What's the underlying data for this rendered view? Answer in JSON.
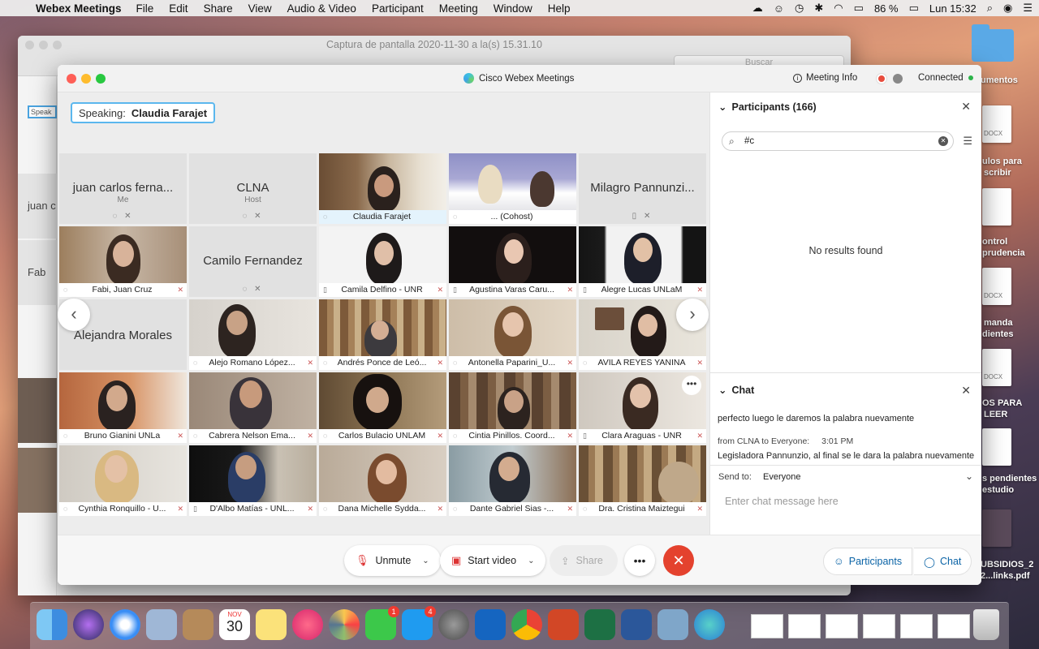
{
  "menubar": {
    "app": "Webex Meetings",
    "items": [
      "File",
      "Edit",
      "Share",
      "View",
      "Audio & Video",
      "Participant",
      "Meeting",
      "Window",
      "Help"
    ],
    "battery": "86 %",
    "clock": "Lun 15:32"
  },
  "desktop": {
    "labels": [
      "umentos",
      "ulos para",
      "scribir",
      "ontrol",
      "prudencia",
      "manda",
      "dientes",
      "OS PARA",
      "LEER",
      "s pendientes",
      "estudio",
      "UBSIDIOS_2",
      "2...links.pdf"
    ],
    "docx": [
      "DOCX",
      "DOCX",
      "DOCX"
    ]
  },
  "bg_window": {
    "title": "Captura de pantalla 2020-11-30 a la(s) 15.31.10",
    "search_placeholder": "Buscar",
    "thumb_label": "Speak",
    "ghosts": [
      "juan c",
      "Fab"
    ]
  },
  "window": {
    "title": "Cisco Webex Meetings",
    "meeting_info": "Meeting Info",
    "status": "Connected",
    "colors": {
      "accent": "#5bb7ee",
      "end": "#e4422e",
      "link": "#0a63a6"
    }
  },
  "speaking": {
    "label": "Speaking:",
    "name": "Claudia Farajet"
  },
  "tiles": [
    {
      "name": "juan carlos ferna...",
      "role": "Me",
      "video": false
    },
    {
      "name": "CLNA",
      "role": "Host",
      "video": false
    },
    {
      "name": "Claudia Farajet",
      "video": true,
      "active": true
    },
    {
      "name": "... (Cohost)",
      "video": true
    },
    {
      "name": "Milagro Pannunzi...",
      "video": false
    },
    {
      "name": "Fabi, Juan Cruz",
      "video": true
    },
    {
      "name": "Camilo Fernandez",
      "video": false
    },
    {
      "name": "Camila Delfino - UNR",
      "video": true
    },
    {
      "name": "Agustina Varas Caru...",
      "video": true
    },
    {
      "name": "Alegre Lucas UNLaM",
      "video": true
    },
    {
      "name": "Alejandra Morales",
      "video": false
    },
    {
      "name": "Alejo Romano López...",
      "video": true
    },
    {
      "name": "Andrés Ponce de Leó...",
      "video": true
    },
    {
      "name": "Antonella Paparini_U...",
      "video": true
    },
    {
      "name": "AVILA REYES YANINA",
      "video": true
    },
    {
      "name": "Bruno Gianini UNLa",
      "video": true
    },
    {
      "name": "Cabrera Nelson Ema...",
      "video": true
    },
    {
      "name": "Carlos Bulacio UNLAM",
      "video": true
    },
    {
      "name": "Cintia Pinillos. Coord...",
      "video": true
    },
    {
      "name": "Clara Araguas - UNR",
      "video": true
    },
    {
      "name": "Cynthia Ronquillo - U...",
      "video": true
    },
    {
      "name": "D'Albo Matías - UNL...",
      "video": true
    },
    {
      "name": "Dana Michelle Sydda...",
      "video": true
    },
    {
      "name": "Dante Gabriel Sias -...",
      "video": true
    },
    {
      "name": "Dra. Cristina Maiztegui",
      "video": true
    }
  ],
  "participants": {
    "title": "Participants (166)",
    "search_value": "#c",
    "empty": "No results found"
  },
  "chat": {
    "title": "Chat",
    "message1": "perfecto luego le daremos la palabra nuevamente",
    "meta": "from CLNA to Everyone:",
    "time": "3:01 PM",
    "message2": "Legisladora Pannunzio, al final se le dara la palabra nuevamente",
    "send_to_label": "Send to:",
    "send_to_value": "Everyone",
    "input_placeholder": "Enter chat message here"
  },
  "controls": {
    "unmute": "Unmute",
    "start_video": "Start video",
    "share": "Share",
    "participants": "Participants",
    "chat": "Chat"
  },
  "dock": {
    "calendar_month": "NOV",
    "calendar_day": "30",
    "badge_facetime": "1",
    "badge_appstore": "4"
  }
}
